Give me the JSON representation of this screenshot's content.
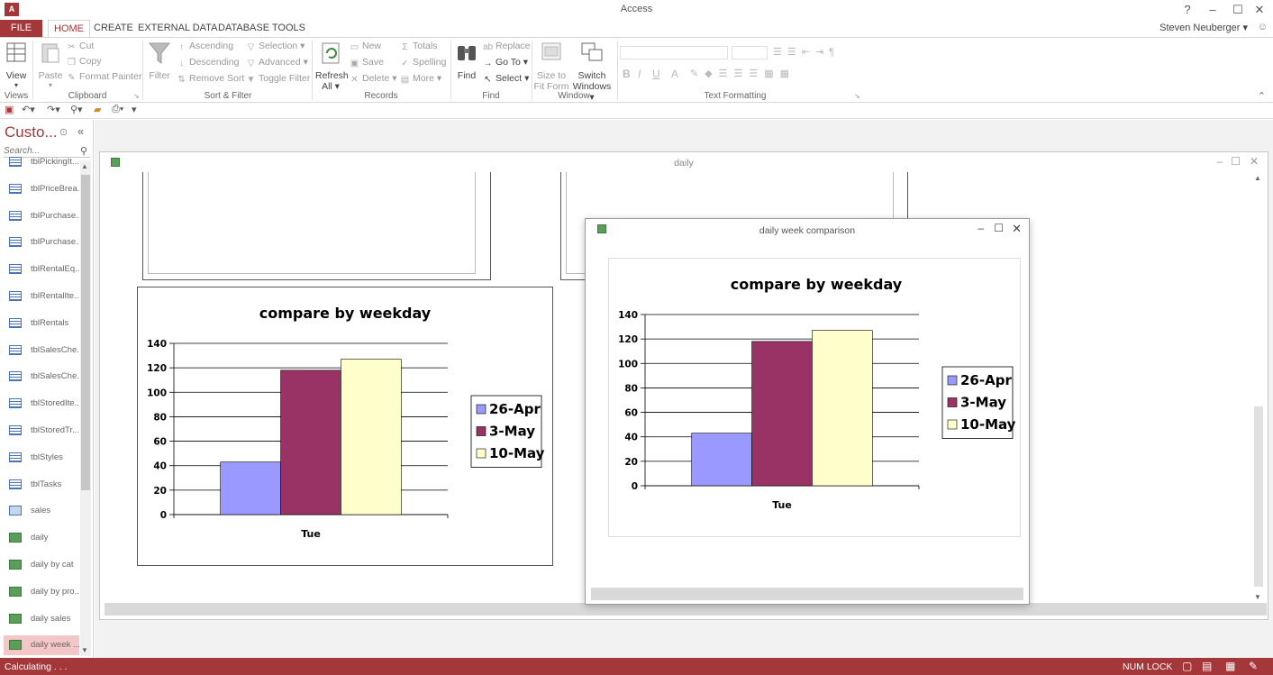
{
  "app": {
    "title": "Access",
    "user": "Steven Neuberger",
    "icon": "A"
  },
  "menu": {
    "file": "FILE",
    "tabs": [
      "HOME",
      "CREATE",
      "EXTERNAL DATA",
      "DATABASE TOOLS"
    ]
  },
  "ribbon": {
    "views": {
      "view": "View",
      "label": "Views"
    },
    "clipboard": {
      "paste": "Paste",
      "cut": "Cut",
      "copy": "Copy",
      "format_painter": "Format Painter",
      "label": "Clipboard"
    },
    "sort_filter": {
      "filter": "Filter",
      "ascending": "Ascending",
      "descending": "Descending",
      "remove_sort": "Remove Sort",
      "selection": "Selection",
      "advanced": "Advanced",
      "toggle_filter": "Toggle Filter",
      "label": "Sort & Filter"
    },
    "records": {
      "refresh": "Refresh",
      "refresh_all": "All",
      "new": "New",
      "save": "Save",
      "delete": "Delete",
      "totals": "Totals",
      "spelling": "Spelling",
      "more": "More",
      "label": "Records"
    },
    "find": {
      "find": "Find",
      "replace": "Replace",
      "goto": "Go To",
      "select": "Select",
      "label": "Find"
    },
    "window": {
      "size_to": "Size to",
      "fit_form": "Fit Form",
      "switch": "Switch",
      "windows": "Windows",
      "label": "Window"
    },
    "text_formatting": {
      "label": "Text Formatting",
      "bold": "B",
      "italic": "I",
      "underline": "U",
      "font_color": "A"
    }
  },
  "nav": {
    "title": "Custo...",
    "search_placeholder": "Search...",
    "items": [
      {
        "label": "tblPickingIt...",
        "type": "table"
      },
      {
        "label": "tblPriceBrea...",
        "type": "table"
      },
      {
        "label": "tblPurchase...",
        "type": "table"
      },
      {
        "label": "tblPurchase...",
        "type": "table"
      },
      {
        "label": "tblRentalEq...",
        "type": "table"
      },
      {
        "label": "tblRentalIte...",
        "type": "table"
      },
      {
        "label": "tblRentals",
        "type": "table"
      },
      {
        "label": "tblSalesChe...",
        "type": "table"
      },
      {
        "label": "tblSalesChe...",
        "type": "table"
      },
      {
        "label": "tblStoredIte...",
        "type": "table"
      },
      {
        "label": "tblStoredTr...",
        "type": "table"
      },
      {
        "label": "tblStyles",
        "type": "table"
      },
      {
        "label": "tblTasks",
        "type": "table"
      },
      {
        "label": "sales",
        "type": "query"
      },
      {
        "label": "daily",
        "type": "report"
      },
      {
        "label": "daily by cat",
        "type": "report"
      },
      {
        "label": "daily by pro...",
        "type": "report"
      },
      {
        "label": "daily sales",
        "type": "report"
      },
      {
        "label": "daily week ...",
        "type": "report"
      }
    ]
  },
  "mdi": {
    "title": "daily"
  },
  "popup": {
    "title": "daily week comparison"
  },
  "status": {
    "left": "Calculating . . .",
    "numlock": "NUM LOCK"
  },
  "chart_data": [
    {
      "type": "bar",
      "title": "compare by weekday",
      "categories": [
        "Tue"
      ],
      "series": [
        {
          "name": "26-Apr",
          "values": [
            43
          ],
          "color": "#9999ff"
        },
        {
          "name": "3-May",
          "values": [
            118
          ],
          "color": "#993366"
        },
        {
          "name": "10-May",
          "values": [
            127
          ],
          "color": "#ffffcc"
        }
      ],
      "ylim": [
        0,
        140
      ],
      "yticks": [
        "0",
        "20",
        "40",
        "60",
        "80",
        "100",
        "120",
        "140"
      ],
      "grid": true,
      "legend": "right"
    },
    {
      "type": "bar",
      "title": "compare by weekday",
      "categories": [
        "Tue"
      ],
      "series": [
        {
          "name": "26-Apr",
          "values": [
            43
          ],
          "color": "#9999ff"
        },
        {
          "name": "3-May",
          "values": [
            118
          ],
          "color": "#993366"
        },
        {
          "name": "10-May",
          "values": [
            127
          ],
          "color": "#ffffcc"
        }
      ],
      "ylim": [
        0,
        140
      ],
      "yticks": [
        "0",
        "20",
        "40",
        "60",
        "80",
        "100",
        "120",
        "140"
      ],
      "grid": true,
      "legend": "right"
    }
  ]
}
